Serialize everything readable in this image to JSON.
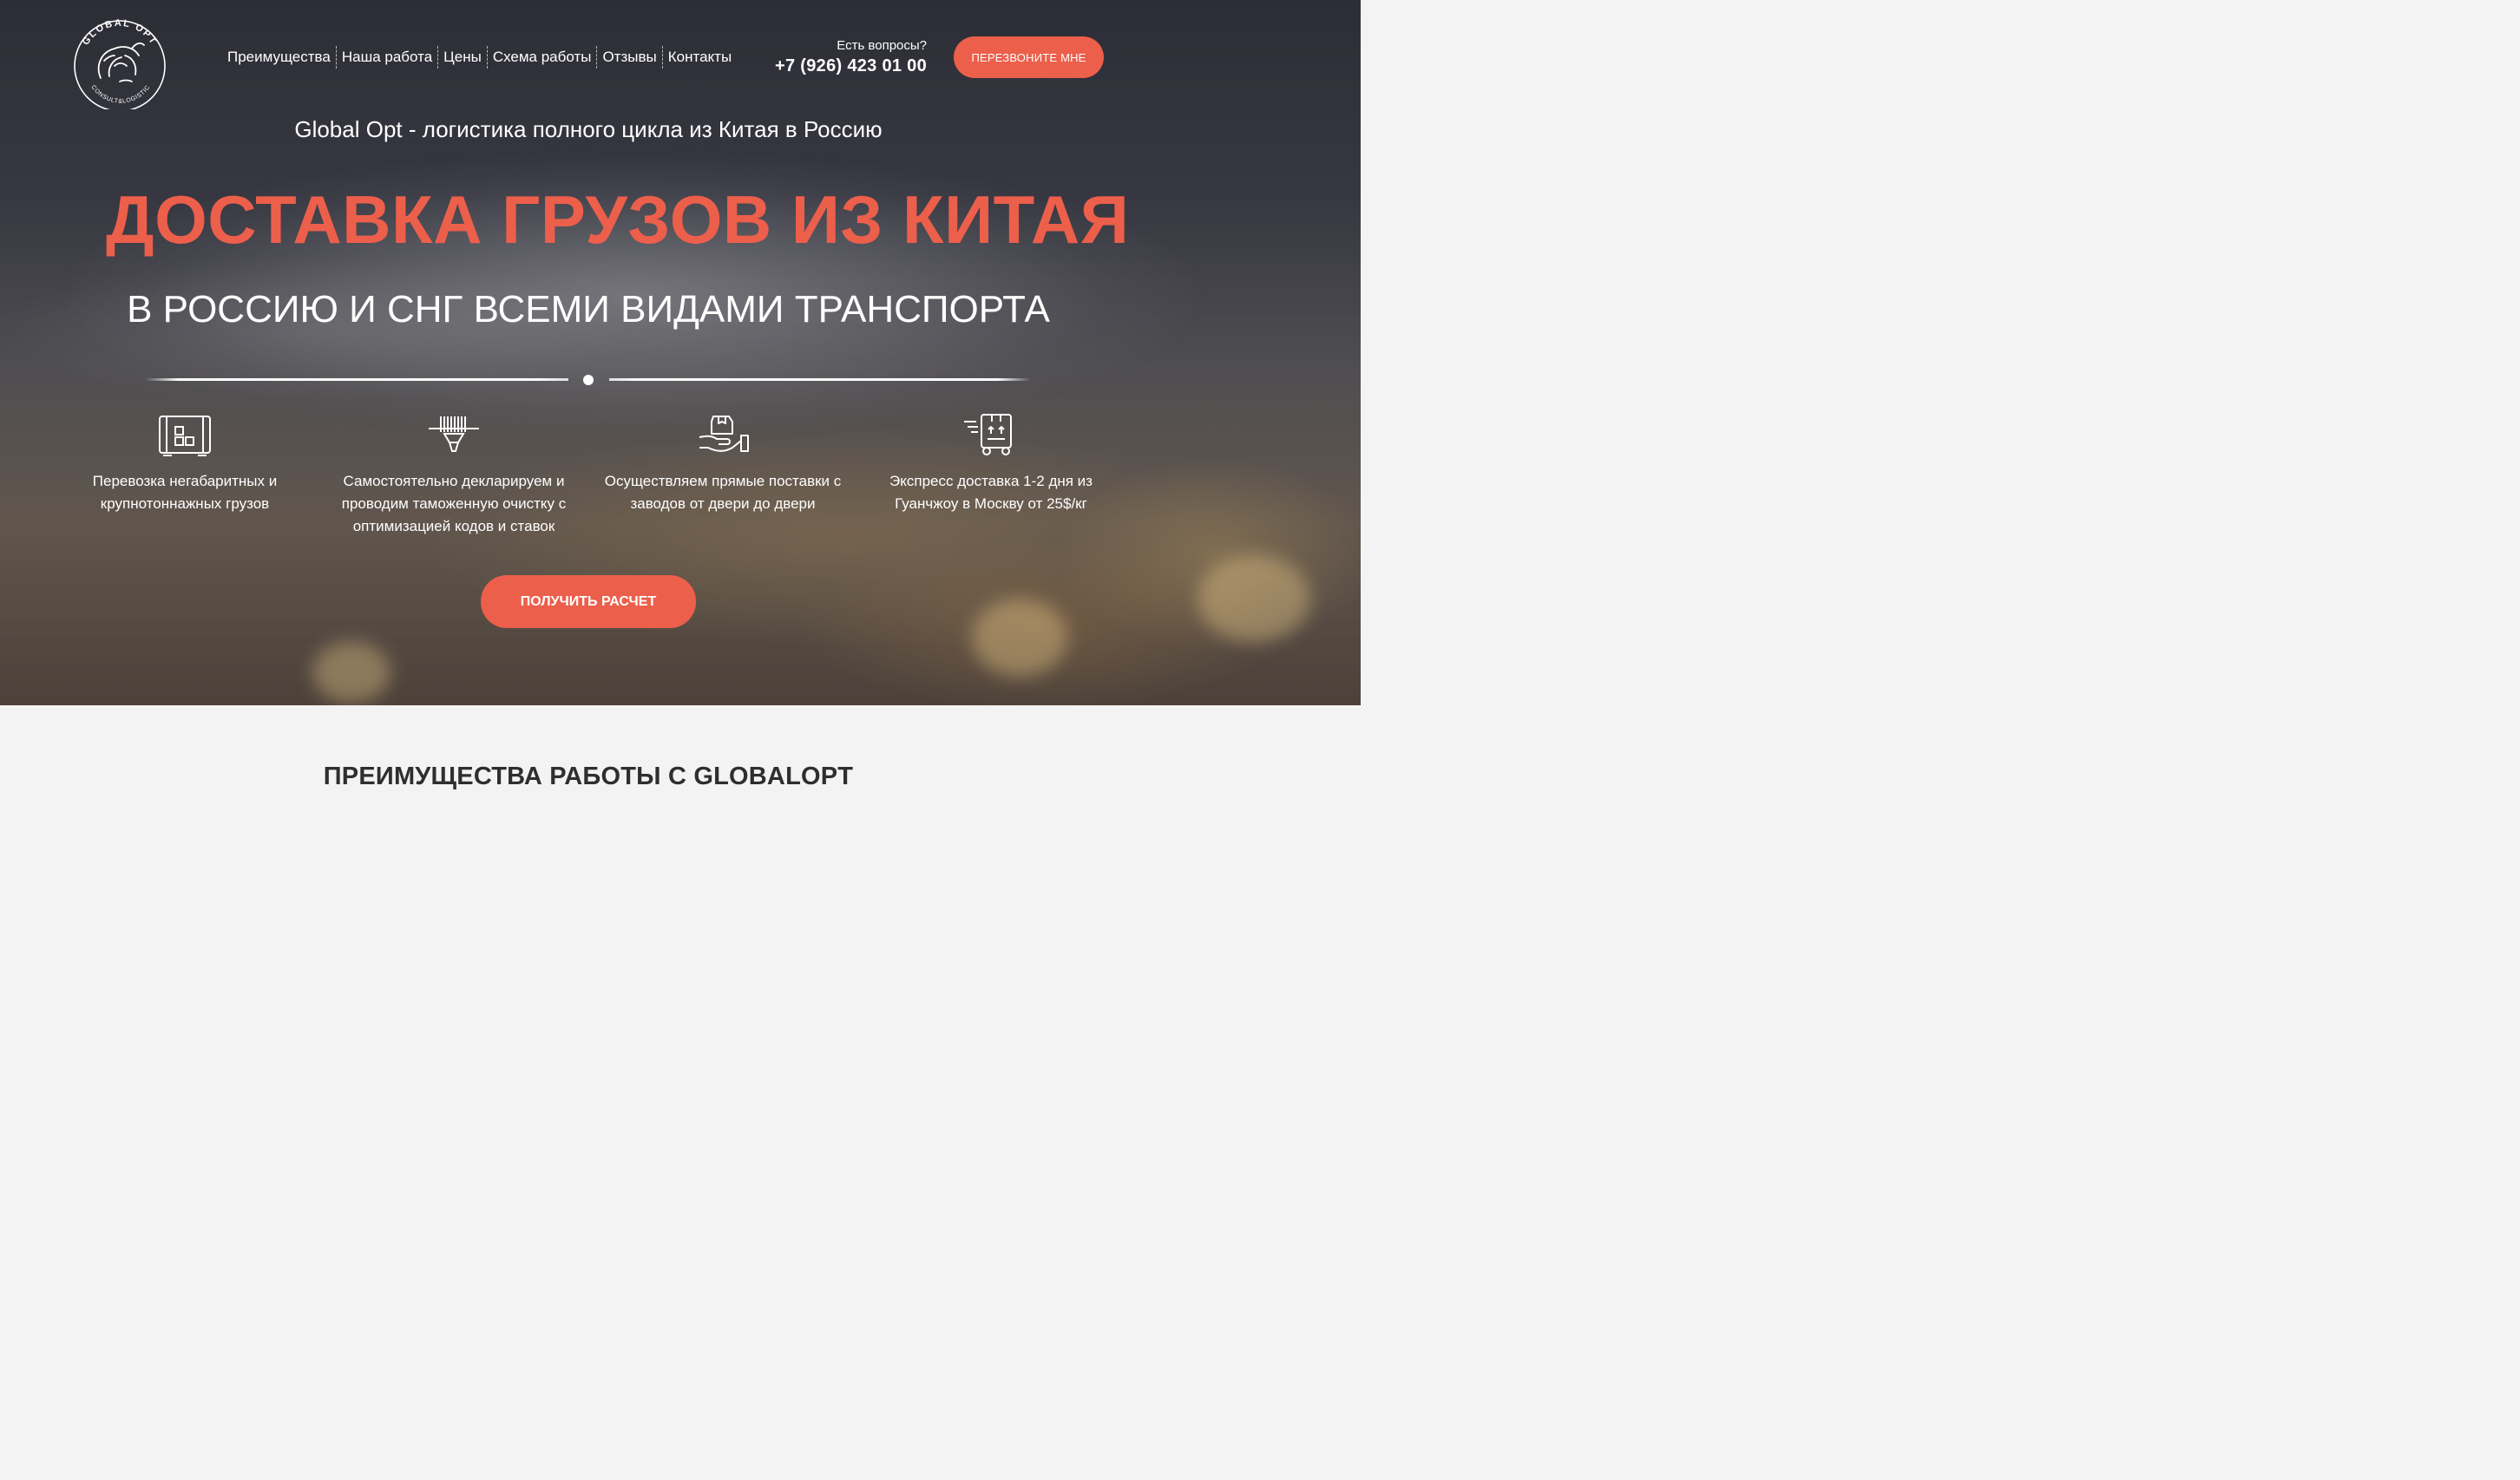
{
  "logo": {
    "name": "GLOBAL OPT",
    "tagline": "CONSULT&LOGISTIC"
  },
  "nav": {
    "items": [
      {
        "label": "Преимущества"
      },
      {
        "label": "Наша работа"
      },
      {
        "label": "Цены"
      },
      {
        "label": "Схема работы"
      },
      {
        "label": "Отзывы"
      },
      {
        "label": "Контакты"
      }
    ]
  },
  "contact": {
    "question": "Есть вопросы?",
    "phone": "+7 (926) 423 01 00",
    "callback_label": "ПЕРЕЗВОНИТЕ МНЕ"
  },
  "hero": {
    "tagline": "Global Opt - логистика полного цикла из Китая в Россию",
    "headline": "ДОСТАВКА ГРУЗОВ ИЗ КИТАЯ",
    "subheadline": "В РОССИЮ И СНГ ВСЕМИ ВИДАМИ ТРАНСПОРТА",
    "cta_label": "ПОЛУЧИТЬ РАСЧЕТ"
  },
  "features": [
    {
      "icon": "container-icon",
      "text": "Перевозка негабаритных и крупнотоннажных грузов"
    },
    {
      "icon": "barcode-scanner-icon",
      "text": "Самостоятельно декларируем и проводим таможенную очистку с оптимизацией кодов и ставок"
    },
    {
      "icon": "hand-box-icon",
      "text": "Осуществляем прямые поставки с заводов от двери до двери"
    },
    {
      "icon": "express-delivery-icon",
      "text": "Экспресс доставка 1-2 дня из Гуанчжоу в Москву от 25$/кг"
    }
  ],
  "advantages": {
    "title": "ПРЕИМУЩЕСТВА РАБОТЫ С GLOBALOPT"
  },
  "colors": {
    "accent": "#ec5f4b",
    "text_light": "#ffffff",
    "text_dark": "#2e2e2e",
    "section_bg": "#f3f3f3"
  }
}
